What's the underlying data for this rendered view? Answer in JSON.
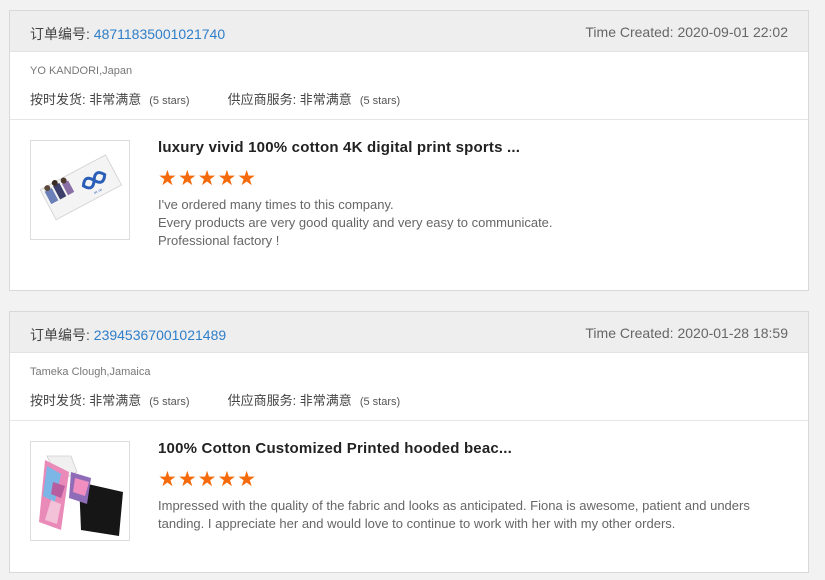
{
  "reviews": [
    {
      "order_label": "订单编号:",
      "order_number": "48711835001021740",
      "time_created": "Time Created: 2020-09-01 22:02",
      "buyer": "YO KANDORI,Japan",
      "on_time_label": "按时发货: 非常满意",
      "on_time_stars": "(5 stars)",
      "supplier_label": "供应商服务: 非常满意",
      "supplier_stars": "(5 stars)",
      "product_title": "luxury vivid 100% cotton 4K digital print sports ...",
      "rating_stars": 5,
      "star_glyphs": "★★★★★",
      "review_lines": [
        "I've ordered many times to this company.",
        "Every products are very good quality and very easy to communicate.",
        "Professional factory !"
      ]
    },
    {
      "order_label": "订单编号:",
      "order_number": "23945367001021489",
      "time_created": "Time Created: 2020-01-28 18:59",
      "buyer": "Tameka Clough,Jamaica",
      "on_time_label": "按时发货: 非常满意",
      "on_time_stars": "(5 stars)",
      "supplier_label": "供应商服务: 非常满意",
      "supplier_stars": "(5 stars)",
      "product_title": "100% Cotton Customized Printed hooded beac...",
      "rating_stars": 5,
      "star_glyphs": "★★★★★",
      "review_lines": [
        "Impressed with the quality of the fabric and looks as anticipated.  Fiona is awesome, patient and unders",
        "tanding.  I appreciate her and would love to continue to work with her with my other orders."
      ]
    }
  ],
  "colors": {
    "link": "#2f7ec9",
    "star": "#f56a0a",
    "header_bg": "#eeeeee"
  }
}
